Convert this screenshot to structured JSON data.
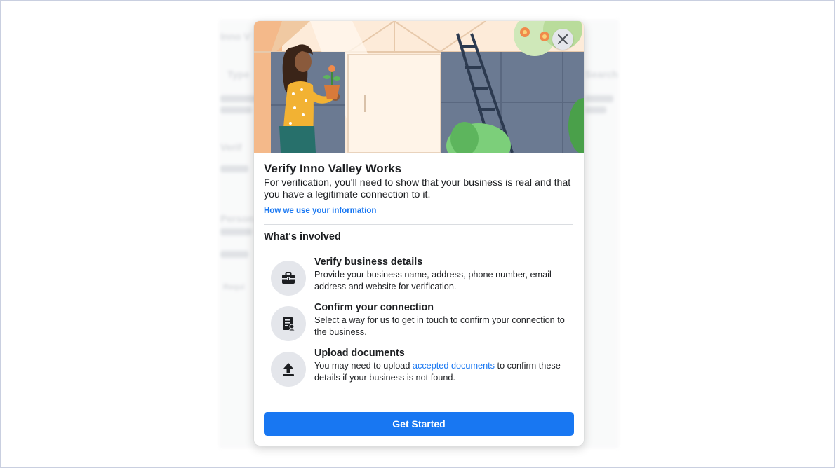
{
  "background_page": {
    "fragments": [
      "Inno V",
      "Type",
      "Verif",
      "Person",
      "Requi",
      "Search"
    ]
  },
  "modal": {
    "title": "Verify Inno Valley Works",
    "description": "For verification, you'll need to show that your business is real and that you have a legitimate connection to it.",
    "info_link": "How we use your information",
    "section_title": "What's involved",
    "close_icon": "close-icon",
    "steps": [
      {
        "icon": "briefcase-icon",
        "title": "Verify business details",
        "description": "Provide your business name, address, phone number, email address and website for verification."
      },
      {
        "icon": "document-person-icon",
        "title": "Confirm your connection",
        "description": "Select a way for us to get in touch to confirm your connection to the business."
      },
      {
        "icon": "upload-icon",
        "title": "Upload documents",
        "description_before": "You may need to upload ",
        "description_link": "accepted documents",
        "description_after": " to confirm these details if your business is not found."
      }
    ],
    "cta_label": "Get Started"
  },
  "colors": {
    "accent": "#1877f2",
    "icon_bg": "#e4e6eb",
    "text": "#1c1e21"
  }
}
